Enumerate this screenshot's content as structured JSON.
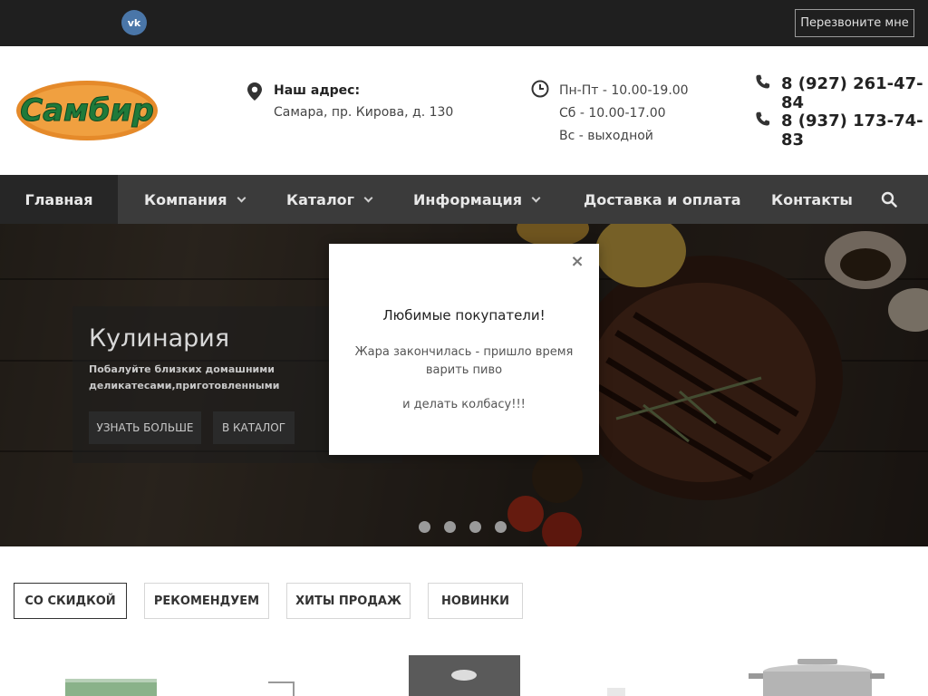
{
  "topbar": {
    "vk_label": "vk",
    "callback": "Перезвоните мне"
  },
  "logo": {
    "text": "Самбир"
  },
  "address": {
    "title": "Наш адрес:",
    "text": "Самара, пр. Кирова, д. 130"
  },
  "hours": {
    "line1": "Пн-Пт - 10.00-19.00",
    "line2": "Сб - 10.00-17.00",
    "line3": "Вс - выходной"
  },
  "phones": [
    "8 (927) 261-47-84",
    "8 (937) 173-74-83"
  ],
  "nav": {
    "items": [
      {
        "label": "Главная"
      },
      {
        "label": "Компания"
      },
      {
        "label": "Каталог"
      },
      {
        "label": "Информация"
      },
      {
        "label": "Доставка и оплата"
      },
      {
        "label": "Контакты"
      }
    ]
  },
  "slide": {
    "title": "Кулинария",
    "text": "Побалуйте близких домашними деликатесами,приготовленными собственноручно",
    "btn_more": "УЗНАТЬ БОЛЬШЕ",
    "btn_catalog": "В КАТАЛОГ"
  },
  "modal": {
    "close": "×",
    "title": "Любимые покупатели!",
    "text1": "Жара закончилась - пришло время варить пиво",
    "text2": "и делать колбасу!!!"
  },
  "tabs": [
    "СО СКИДКОЙ",
    "РЕКОМЕНДУЕМ",
    "ХИТЫ ПРОДАЖ",
    "НОВИНКИ"
  ],
  "colors": {
    "logo_green": "#1f7a3a",
    "logo_orange": "#e58a2a",
    "topbar": "#1f1f1f",
    "nav": "#3b3b3b"
  }
}
